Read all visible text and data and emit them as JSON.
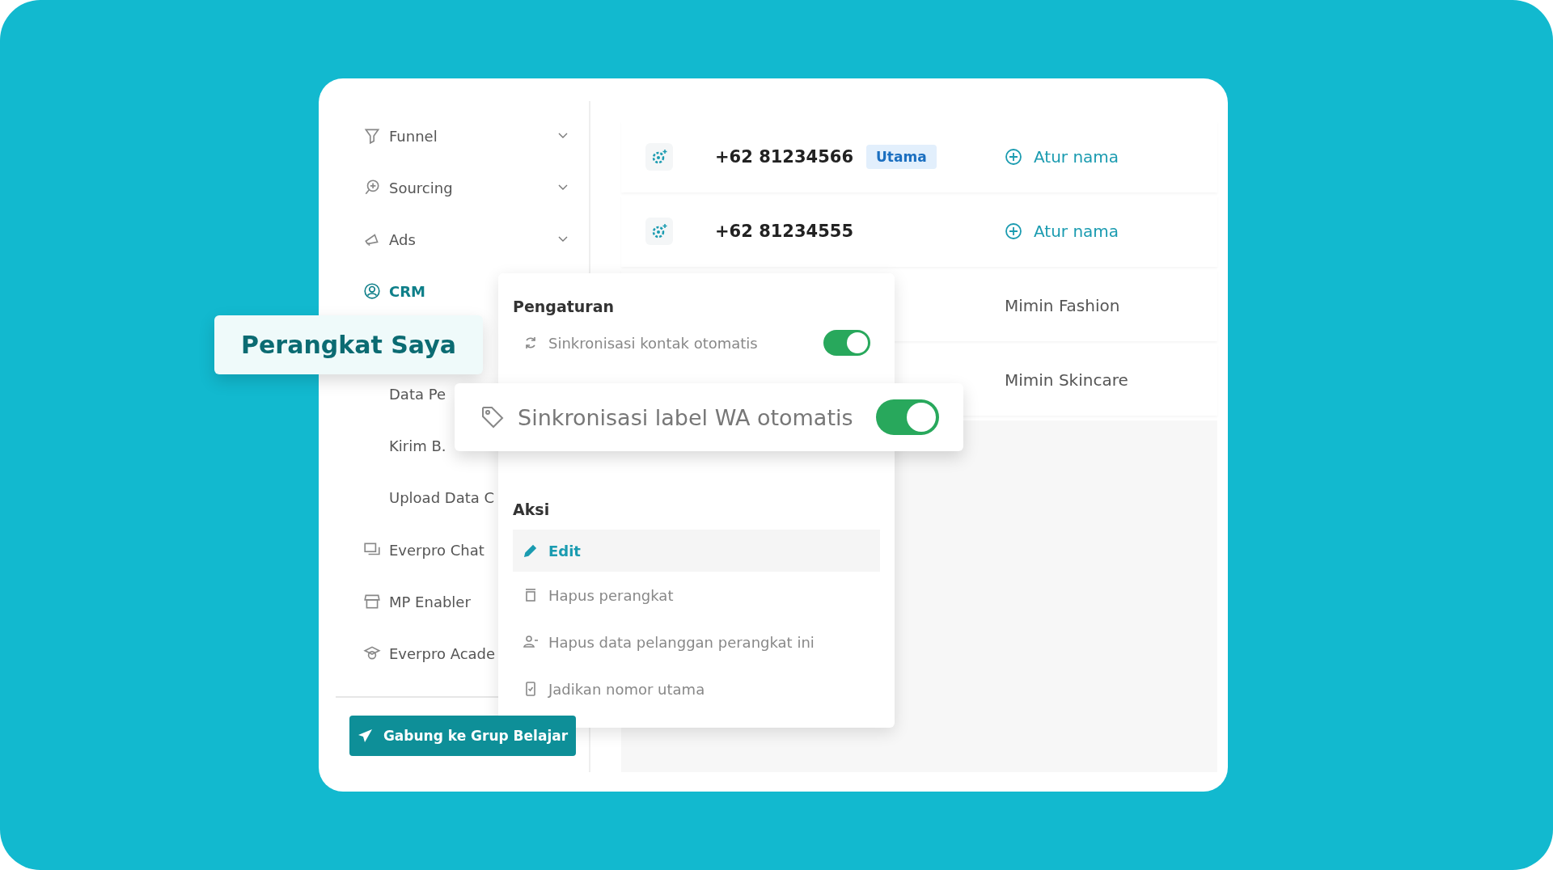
{
  "sidebar": {
    "items": [
      {
        "label": "Funnel",
        "expandable": true,
        "selected": false
      },
      {
        "label": "Sourcing",
        "expandable": true,
        "selected": false
      },
      {
        "label": "Ads",
        "expandable": true,
        "selected": false
      },
      {
        "label": "CRM",
        "expandable": false,
        "selected": true,
        "children": [
          {
            "label": "Data Pe"
          },
          {
            "label": "Kirim B."
          },
          {
            "label": "Upload Data C"
          }
        ]
      },
      {
        "label": "Everpro Chat",
        "expandable": false,
        "selected": false
      },
      {
        "label": "MP Enabler",
        "expandable": false,
        "selected": false
      },
      {
        "label": "Everpro Acade",
        "expandable": false,
        "selected": false
      }
    ],
    "button": "Gabung ke Grup Belajar"
  },
  "callout": {
    "label": "Perangkat Saya"
  },
  "devices": [
    {
      "phone": "+62 81234566",
      "badge": "Utama",
      "action": "Atur nama"
    },
    {
      "phone": "+62 81234555",
      "action": "Atur nama"
    },
    {
      "name": "Mimin Fashion"
    },
    {
      "name": "Mimin Skincare"
    }
  ],
  "menu": {
    "settings_title": "Pengaturan",
    "settings": [
      {
        "label": "Sinkronisasi kontak otomatis",
        "on": true
      }
    ],
    "actions_title": "Aksi",
    "actions": [
      {
        "label": "Edit",
        "selected": true
      },
      {
        "label": "Hapus perangkat",
        "selected": false
      },
      {
        "label": "Hapus data pelanggan perangkat ini",
        "selected": false
      },
      {
        "label": "Jadikan nomor utama",
        "selected": false
      }
    ]
  },
  "highlight": {
    "label": "Sinkronisasi label WA otomatis",
    "on": true
  }
}
